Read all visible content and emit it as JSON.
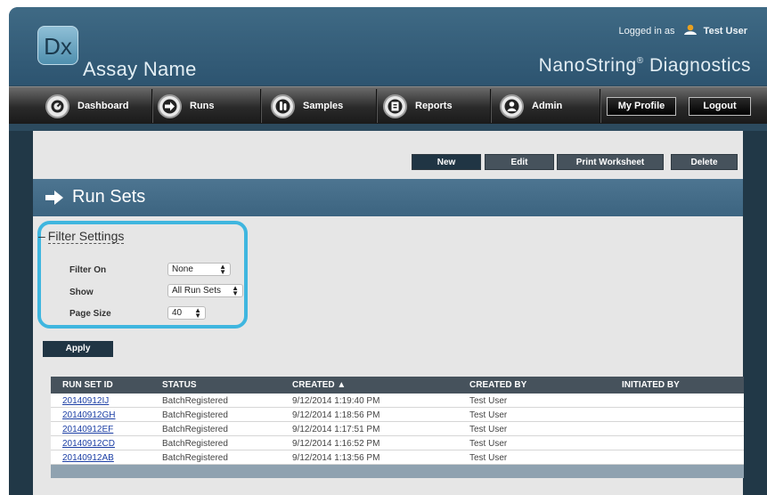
{
  "header": {
    "logo_text": "Dx",
    "app_name": "Assay Name",
    "logged_in_prefix": "Logged in as",
    "user_name": "Test User",
    "brand": "NanoString",
    "brand_mark": "®",
    "brand_suffix": " Diagnostics"
  },
  "nav": {
    "items": [
      {
        "label": "Dashboard",
        "icon": "dashboard-icon"
      },
      {
        "label": "Runs",
        "icon": "arrow-right-icon"
      },
      {
        "label": "Samples",
        "icon": "sample-tubes-icon"
      },
      {
        "label": "Reports",
        "icon": "report-icon"
      },
      {
        "label": "Admin",
        "icon": "admin-user-icon"
      }
    ],
    "my_profile_label": "My Profile",
    "logout_label": "Logout"
  },
  "toolbar": {
    "new_label": "New",
    "edit_label": "Edit",
    "print_label": "Print Worksheet",
    "delete_label": "Delete"
  },
  "page": {
    "title": "Run Sets"
  },
  "filter": {
    "collapse_symbol": "–",
    "heading": "Filter Settings",
    "filter_on_label": "Filter On",
    "filter_on_value": "None",
    "show_label": "Show",
    "show_value": "All Run Sets",
    "page_size_label": "Page Size",
    "page_size_value": "40",
    "apply_label": "Apply"
  },
  "table": {
    "columns": [
      "RUN SET ID",
      "STATUS",
      "CREATED ▲",
      "CREATED BY",
      "INITIATED BY"
    ],
    "rows": [
      {
        "id": "20140912IJ",
        "status": "BatchRegistered",
        "created": "9/12/2014 1:19:40 PM",
        "created_by": "Test User",
        "initiated_by": ""
      },
      {
        "id": "20140912GH",
        "status": "BatchRegistered",
        "created": "9/12/2014 1:18:56 PM",
        "created_by": "Test User",
        "initiated_by": ""
      },
      {
        "id": "20140912EF",
        "status": "BatchRegistered",
        "created": "9/12/2014 1:17:51 PM",
        "created_by": "Test User",
        "initiated_by": ""
      },
      {
        "id": "20140912CD",
        "status": "BatchRegistered",
        "created": "9/12/2014 1:16:52 PM",
        "created_by": "Test User",
        "initiated_by": ""
      },
      {
        "id": "20140912AB",
        "status": "BatchRegistered",
        "created": "9/12/2014 1:13:56 PM",
        "created_by": "Test User",
        "initiated_by": ""
      }
    ]
  },
  "colors": {
    "header_blue": "#3f6a85",
    "highlight_cyan": "#3fb6df",
    "link_blue": "#1c3fa5",
    "table_header": "#46525c"
  }
}
